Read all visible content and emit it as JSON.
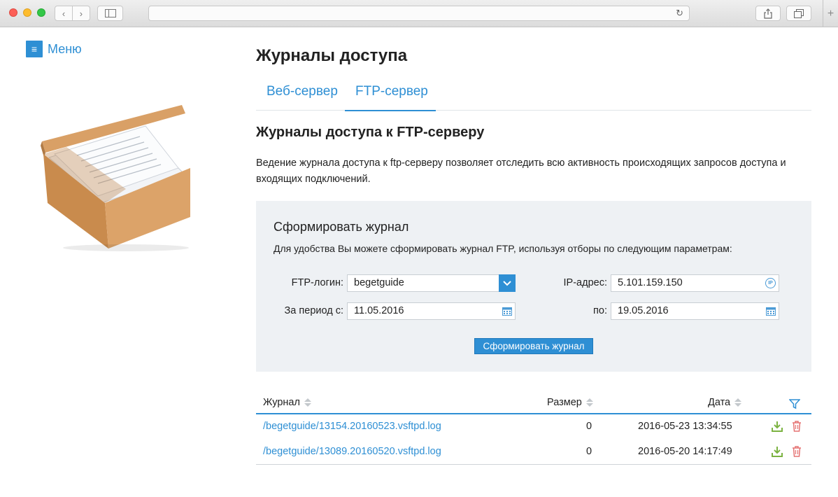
{
  "browser": {
    "back_glyph": "‹",
    "forward_glyph": "›",
    "reload_glyph": "↻",
    "new_tab_glyph": "+"
  },
  "sidebar": {
    "menu_label": "Меню",
    "menu_icon": "hamburger-icon"
  },
  "page": {
    "title": "Журналы доступа",
    "tabs": [
      {
        "label": "Веб-сервер",
        "active": false
      },
      {
        "label": "FTP-сервер",
        "active": true
      }
    ],
    "section_title": "Журналы доступа к FTP-серверу",
    "description": "Ведение журнала доступа к ftp-серверу позволяет отследить всю активность происходящих запросов доступа и входящих подключений."
  },
  "form": {
    "title": "Сформировать журнал",
    "description": "Для удобства Вы можете сформировать журнал FTP, используя отборы по следующим параметрам:",
    "ftp_login_label": "FTP-логин:",
    "ftp_login_value": "begetguide",
    "ip_label": "IP-адрес:",
    "ip_value": "5.101.159.150",
    "period_from_label": "За период с:",
    "period_from_value": "11.05.2016",
    "period_to_label": "по:",
    "period_to_value": "19.05.2016",
    "submit_label": "Сформировать журнал"
  },
  "table": {
    "columns": {
      "journal": "Журнал",
      "size": "Размер",
      "date": "Дата"
    },
    "rows": [
      {
        "file": "/begetguide/13154.20160523.vsftpd.log",
        "size": "0",
        "date": "2016-05-23 13:34:55"
      },
      {
        "file": "/begetguide/13089.20160520.vsftpd.log",
        "size": "0",
        "date": "2016-05-20 14:17:49"
      }
    ]
  },
  "colors": {
    "accent": "#2e8fd4",
    "panel_bg": "#eef1f4",
    "download_icon": "#7cb342",
    "delete_icon": "#e57373"
  }
}
